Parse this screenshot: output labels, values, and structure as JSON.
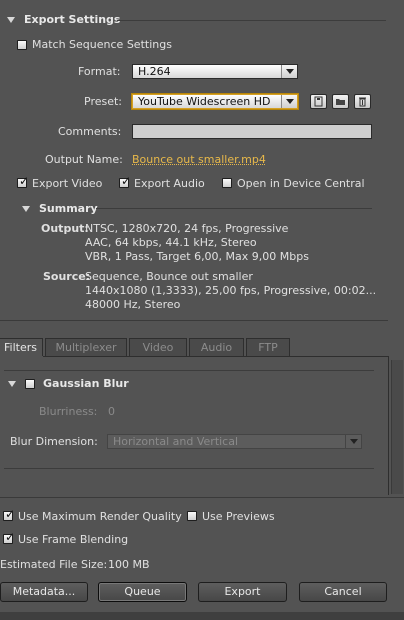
{
  "export_settings": {
    "section_title": "Export Settings",
    "match_sequence_label": "Match Sequence Settings",
    "format_label": "Format:",
    "format_value": "H.264",
    "preset_label": "Preset:",
    "preset_value": "YouTube Widescreen HD",
    "comments_label": "Comments:",
    "comments_value": "",
    "output_name_label": "Output Name:",
    "output_name_value": "Bounce out smaller.mp4",
    "export_video_label": "Export Video",
    "export_audio_label": "Export Audio",
    "device_central_label": "Open in Device Central"
  },
  "summary": {
    "title": "Summary",
    "output_label": "Output:",
    "output_lines": [
      "NTSC, 1280x720, 24 fps, Progressive",
      "AAC, 64 kbps, 44.1 kHz, Stereo",
      "VBR, 1 Pass, Target 6,00, Max 9,00 Mbps"
    ],
    "source_label": "Source:",
    "source_lines": [
      "Sequence, Bounce out smaller",
      "1440x1080 (1,3333), 25,00 fps, Progressive, 00:02...",
      "48000 Hz, Stereo"
    ]
  },
  "tabs": [
    "Filters",
    "Multiplexer",
    "Video",
    "Audio",
    "FTP"
  ],
  "filters": {
    "gaussian_blur_label": "Gaussian Blur",
    "blurriness_label": "Blurriness:",
    "blurriness_value": "0",
    "blur_dimension_label": "Blur Dimension:",
    "blur_dimension_value": "Horizontal and Vertical"
  },
  "options": {
    "max_render_quality_label": "Use Maximum Render Quality",
    "use_previews_label": "Use Previews",
    "frame_blending_label": "Use Frame Blending",
    "estimated_size_label": "Estimated File Size:",
    "estimated_size_value": "100 MB"
  },
  "buttons": {
    "metadata": "Metadata...",
    "queue": "Queue",
    "export": "Export",
    "cancel": "Cancel"
  },
  "colors": {
    "panel_bg": "#535353",
    "link": "#e8b94a",
    "preset_focus": "#d4a024"
  }
}
